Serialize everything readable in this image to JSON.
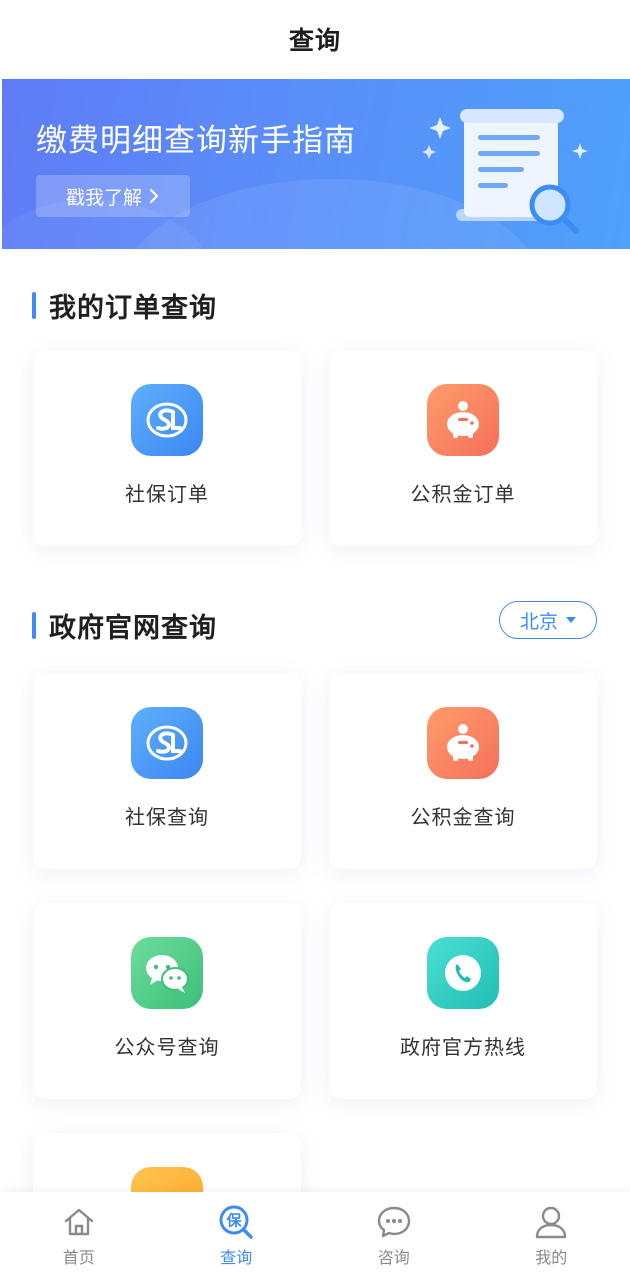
{
  "header": {
    "title": "查询"
  },
  "banner": {
    "title": "缴费明细查询新手指南",
    "button_label": "戳我了解",
    "button_icon": "chevron-right-icon",
    "art_icon": "document-search-icon"
  },
  "section_orders": {
    "title": "我的订单查询",
    "cards": [
      {
        "label": "社保订单",
        "icon": "social-security-icon"
      },
      {
        "label": "公积金订单",
        "icon": "piggy-bank-icon"
      }
    ]
  },
  "section_gov": {
    "title": "政府官网查询",
    "city": {
      "value": "北京",
      "icon": "caret-down-icon"
    },
    "cards": [
      {
        "label": "社保查询",
        "icon": "social-security-icon"
      },
      {
        "label": "公积金查询",
        "icon": "piggy-bank-icon"
      },
      {
        "label": "公众号查询",
        "icon": "wechat-icon"
      },
      {
        "label": "政府官方热线",
        "icon": "phone-icon"
      }
    ]
  },
  "tabbar": {
    "active": "查询",
    "tabs": [
      {
        "label": "首页",
        "icon": "home-icon"
      },
      {
        "label": "查询",
        "icon": "insurance-search-icon"
      },
      {
        "label": "咨询",
        "icon": "chat-icon"
      },
      {
        "label": "我的",
        "icon": "user-icon"
      }
    ]
  },
  "colors": {
    "accent": "#3d8bf5",
    "banner_start": "#5e7bf6",
    "banner_end": "#4ea0fb",
    "icon_blue": "#3b86f2",
    "icon_orange": "#f5705a",
    "icon_green": "#3cbf7a",
    "icon_teal": "#20bdb3",
    "icon_yellow": "#ffa726"
  }
}
